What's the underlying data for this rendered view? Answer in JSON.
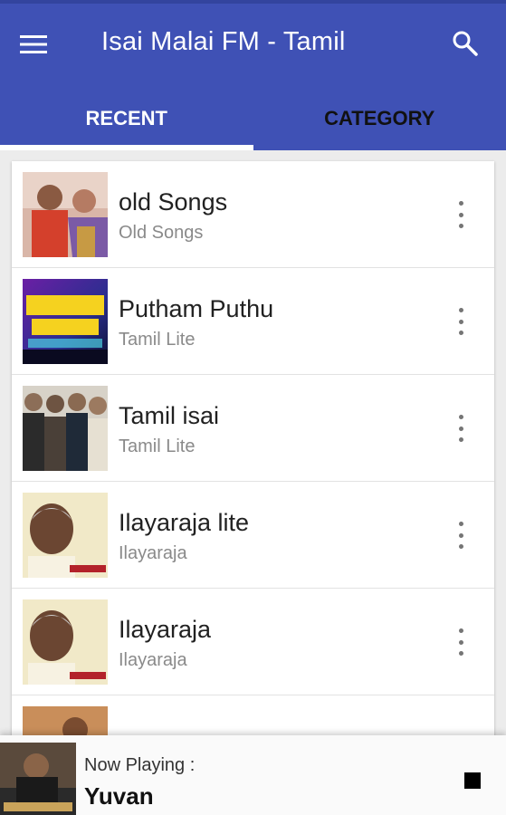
{
  "app": {
    "title": "Isai Malai FM - Tamil",
    "colors": {
      "primary": "#3f51b5",
      "indicator": "#ffffff",
      "subtitle": "#8a8a8a"
    }
  },
  "toolbar": {
    "menu_icon": "menu-icon",
    "search_icon": "search-icon"
  },
  "tabs": [
    {
      "label": "RECENT",
      "active": true
    },
    {
      "label": "CATEGORY",
      "active": false
    }
  ],
  "stations": [
    {
      "title": "old Songs",
      "subtitle": "Old Songs",
      "thumb_icon": "movie-poster-image",
      "more_icon": "more-vert-icon"
    },
    {
      "title": "Putham Puthu",
      "subtitle": "Tamil Lite",
      "thumb_icon": "banner-image",
      "more_icon": "more-vert-icon"
    },
    {
      "title": "Tamil isai",
      "subtitle": "Tamil Lite",
      "thumb_icon": "actors-poster-image",
      "more_icon": "more-vert-icon"
    },
    {
      "title": "Ilayaraja lite",
      "subtitle": "Ilayaraja",
      "thumb_icon": "portrait-image",
      "more_icon": "more-vert-icon"
    },
    {
      "title": "Ilayaraja",
      "subtitle": "Ilayaraja",
      "thumb_icon": "portrait-image",
      "more_icon": "more-vert-icon"
    }
  ],
  "player": {
    "label": "Now Playing :",
    "title": "Yuvan",
    "stop_icon": "stop-icon"
  }
}
